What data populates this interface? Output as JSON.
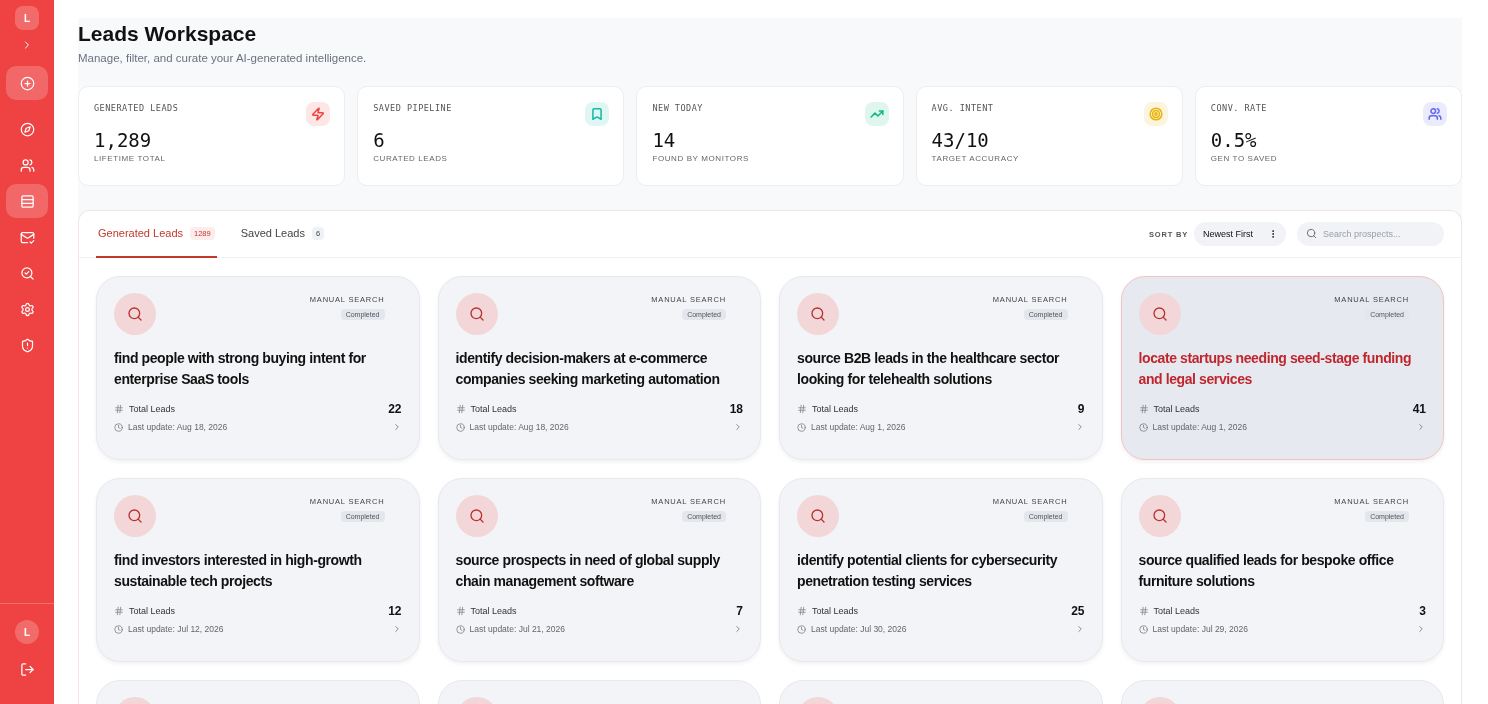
{
  "sidebar": {
    "avatar": "L",
    "new_button": {
      "kind": "new"
    },
    "nav": [
      {
        "kind": "compass",
        "selected": false
      },
      {
        "kind": "users",
        "selected": false
      },
      {
        "kind": "list",
        "selected": true
      },
      {
        "kind": "mail",
        "selected": false
      },
      {
        "kind": "search",
        "selected": false
      },
      {
        "kind": "settings",
        "selected": false
      },
      {
        "kind": "shield",
        "selected": false
      }
    ],
    "user_avatar": "L"
  },
  "header": {
    "title": "Leads Workspace",
    "subtitle": "Manage, filter, and curate your AI-generated intelligence."
  },
  "stats": [
    {
      "kind": "zap",
      "label": "GENERATED LEADS",
      "value": "1,289",
      "caption": "LIFETIME TOTAL",
      "color": "#ef4444"
    },
    {
      "kind": "bookmark",
      "label": "SAVED PIPELINE",
      "value": "6",
      "caption": "CURATED LEADS",
      "color": "#14b8a6"
    },
    {
      "kind": "trend",
      "label": "NEW TODAY",
      "value": "14",
      "caption": "FOUND BY MONITORS",
      "color": "#10b981"
    },
    {
      "kind": "target",
      "label": "AVG. INTENT",
      "value": "43/10",
      "caption": "TARGET ACCURACY",
      "color": "#eab308"
    },
    {
      "kind": "users",
      "label": "CONV. RATE",
      "value": "0.5%",
      "caption": "GEN TO SAVED",
      "color": "#6366f1"
    }
  ],
  "tabs": [
    {
      "label": "Generated Leads",
      "count": "1289",
      "selected": true
    },
    {
      "label": "Saved Leads",
      "count": "6",
      "selected": false
    }
  ],
  "sort": {
    "label": "SORT BY",
    "value": "Newest First"
  },
  "search": {
    "placeholder": "Search prospects..."
  },
  "cards": [
    {
      "source": "MANUAL SEARCH",
      "status": "Completed",
      "title": "find people with strong buying intent for enterprise SaaS tools",
      "total_label": "Total Leads",
      "total": "22",
      "updated": "Last update: Aug 18, 2026",
      "selected": false
    },
    {
      "source": "MANUAL SEARCH",
      "status": "Completed",
      "title": "identify decision-makers at e-commerce companies seeking marketing automation",
      "total_label": "Total Leads",
      "total": "18",
      "updated": "Last update: Aug 18, 2026",
      "selected": false
    },
    {
      "source": "MANUAL SEARCH",
      "status": "Completed",
      "title": "source B2B leads in the healthcare sector looking for telehealth solutions",
      "total_label": "Total Leads",
      "total": "9",
      "updated": "Last update: Aug 1, 2026",
      "selected": false
    },
    {
      "source": "MANUAL SEARCH",
      "status": "Completed",
      "title": "locate startups needing seed-stage funding and legal services",
      "total_label": "Total Leads",
      "total": "41",
      "updated": "Last update: Aug 1, 2026",
      "selected": true
    },
    {
      "source": "MANUAL SEARCH",
      "status": "Completed",
      "title": "find investors interested in high-growth sustainable tech projects",
      "total_label": "Total Leads",
      "total": "12",
      "updated": "Last update: Jul 12, 2026",
      "selected": false
    },
    {
      "source": "MANUAL SEARCH",
      "status": "Completed",
      "title": "source prospects in need of global supply chain management software",
      "total_label": "Total Leads",
      "total": "7",
      "updated": "Last update: Jul 21, 2026",
      "selected": false
    },
    {
      "source": "MANUAL SEARCH",
      "status": "Completed",
      "title": "identify potential clients for cybersecurity penetration testing services",
      "total_label": "Total Leads",
      "total": "25",
      "updated": "Last update: Jul 30, 2026",
      "selected": false
    },
    {
      "source": "MANUAL SEARCH",
      "status": "Completed",
      "title": "source qualified leads for bespoke office furniture solutions",
      "total_label": "Total Leads",
      "total": "3",
      "updated": "Last update: Jul 29, 2026",
      "selected": false
    }
  ],
  "partial_cards": [
    {
      "kind": "search"
    },
    {
      "kind": "search"
    },
    {
      "kind": "search"
    },
    {
      "kind": "search"
    }
  ]
}
